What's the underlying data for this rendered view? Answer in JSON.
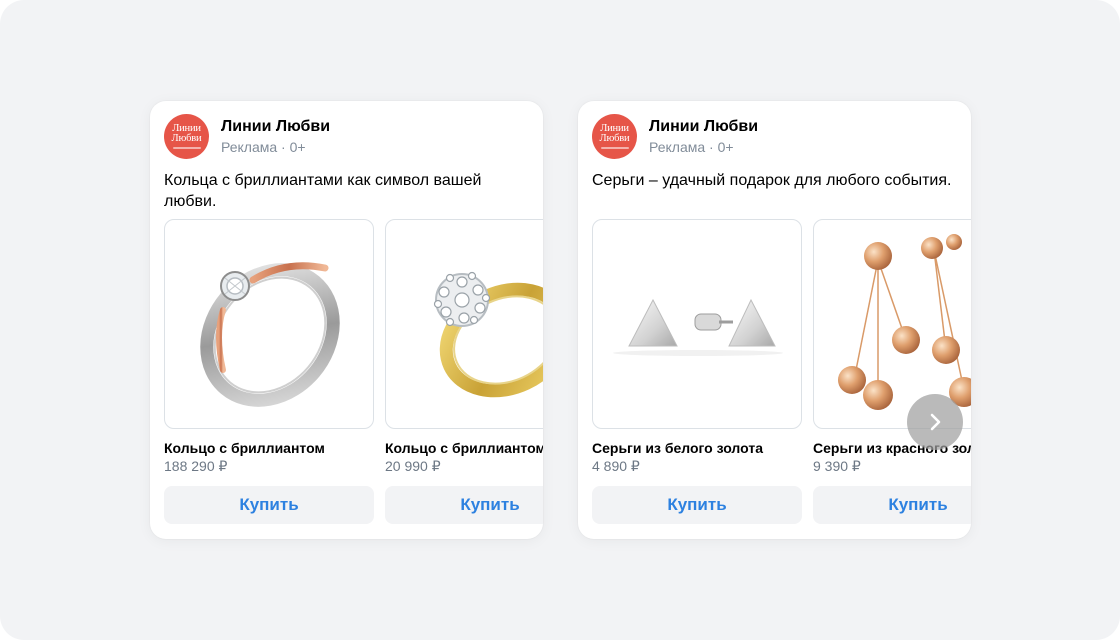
{
  "ads": [
    {
      "brand": "Линии Любви",
      "avatar_text": "Линии\nЛюбви",
      "meta": "Реклама · 0+",
      "text": "Кольца с бриллиантами как символ вашей любви.",
      "products": [
        {
          "title": "Кольцо с бриллиантом",
          "price": "188 290 ₽",
          "button": "Купить",
          "image_icon": "ring-two-tone-icon"
        },
        {
          "title": "Кольцо с бриллиантом",
          "price": "20 990 ₽",
          "button": "Купить",
          "image_icon": "ring-gold-cluster-icon"
        }
      ]
    },
    {
      "brand": "Линии Любви",
      "avatar_text": "Линии\nЛюбви",
      "meta": "Реклама · 0+",
      "text": "Серьги – удачный подарок для любого события.",
      "products": [
        {
          "title": "Серьги из белого золота",
          "price": "4 890 ₽",
          "button": "Купить",
          "image_icon": "triangle-earrings-icon"
        },
        {
          "title": "Серьги из красного золота",
          "price": "9 390 ₽",
          "button": "Купить",
          "image_icon": "bead-earrings-icon"
        }
      ]
    }
  ],
  "colors": {
    "background": "#f2f3f5",
    "avatar": "#e65548",
    "link": "#2d81e0",
    "meta": "#818c99"
  },
  "next_icon": "chevron-right-icon"
}
